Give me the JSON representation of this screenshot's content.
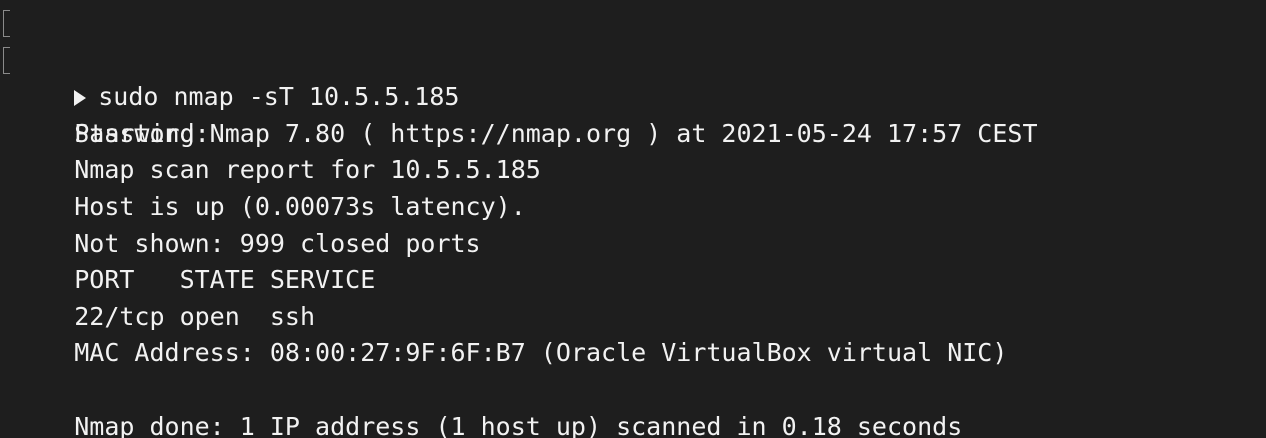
{
  "terminal": {
    "command": "sudo nmap -sT 10.5.5.185",
    "lines": [
      "Password:",
      "Starting Nmap 7.80 ( https://nmap.org ) at 2021-05-24 17:57 CEST",
      "Nmap scan report for 10.5.5.185",
      "Host is up (0.00073s latency).",
      "Not shown: 999 closed ports",
      "PORT   STATE SERVICE",
      "22/tcp open  ssh",
      "MAC Address: 08:00:27:9F:6F:B7 (Oracle VirtualBox virtual NIC)",
      "",
      "Nmap done: 1 IP address (1 host up) scanned in 0.18 seconds"
    ],
    "prompt_icon": "play-triangle-icon",
    "colors": {
      "background": "#1e1e1e",
      "foreground": "#f2f2f2"
    }
  }
}
